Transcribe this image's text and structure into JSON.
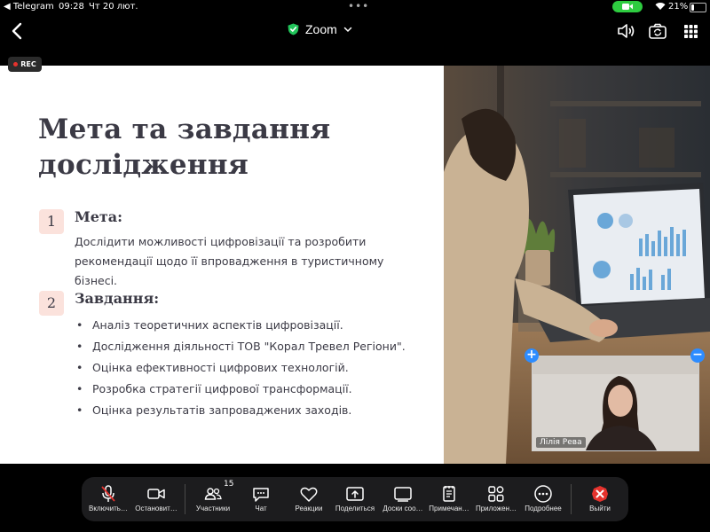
{
  "status_bar": {
    "back_app": "◀ Telegram",
    "time": "09:28",
    "date": "Чт 20 лют.",
    "battery": "21%",
    "battery_level": 0.21
  },
  "nav": {
    "title": "Zoom"
  },
  "rec_label": "REC",
  "slide": {
    "title_line1": "Мета та завдання",
    "title_line2": "дослідження",
    "section1": {
      "number": "1",
      "heading": "Мета:",
      "line1": "Дослідити можливості цифровізації та розробити",
      "line2": "рекомендації щодо її впровадження в туристичному бізнесі."
    },
    "section2": {
      "number": "2",
      "heading": "Завдання:",
      "bullets": [
        "Аналіз теоретичних аспектів цифровізації.",
        "Дослідження діяльності ТОВ \"Корал Тревел Регіони\".",
        "Оцінка ефективності цифрових технологій.",
        "Розробка стратегії цифрової трансформації.",
        "Оцінка результатів запроваджених заходів."
      ],
      "bullet_char": "•"
    }
  },
  "participant": {
    "name": "Лілія Рева"
  },
  "toolbar": {
    "unmute": "Включить…",
    "stop_video": "Остановит…",
    "participants": "Участники",
    "participants_count": "15",
    "chat": "Чат",
    "reactions": "Реакции",
    "share": "Поделиться",
    "whiteboards": "Доски соо…",
    "notes": "Примечан…",
    "apps": "Приложен…",
    "more": "Подробнее",
    "leave": "Выйти"
  },
  "colors": {
    "accent_blue": "#2d8cff",
    "leave_red": "#e5322d",
    "camera_green": "#2ecc40",
    "number_box": "#fbe2dc",
    "slide_text": "#3b3a45"
  }
}
